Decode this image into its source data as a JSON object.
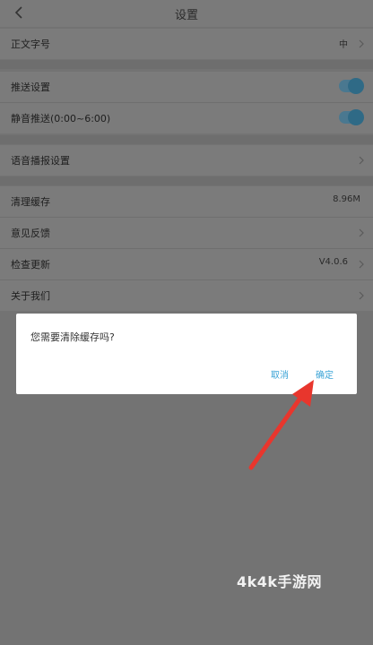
{
  "header": {
    "title": "设置"
  },
  "settings": {
    "font_size": {
      "label": "正文字号",
      "value": "中"
    },
    "push": {
      "label": "推送设置",
      "enabled": true
    },
    "quiet_push": {
      "label": "静音推送(0:00~6:00)",
      "enabled": true
    },
    "voice": {
      "label": "语音播报设置"
    },
    "cache": {
      "label": "清理缓存",
      "value": "8.96M"
    },
    "feedback": {
      "label": "意见反馈"
    },
    "update": {
      "label": "检查更新",
      "value": "V4.0.6"
    },
    "about": {
      "label": "关于我们"
    }
  },
  "dialog": {
    "message": "您需要清除缓存吗?",
    "cancel_label": "取消",
    "confirm_label": "确定"
  },
  "watermark": {
    "text": "4k4k手游网"
  },
  "colors": {
    "accent": "#3aa3d6",
    "arrow": "#e8362d",
    "overlay_bg": "#737373",
    "dialog_bg": "#ffffff"
  },
  "icons": {
    "back": "chevron-left-icon",
    "row_chevron": "chevron-right-icon",
    "annotation": "red-arrow-icon"
  }
}
